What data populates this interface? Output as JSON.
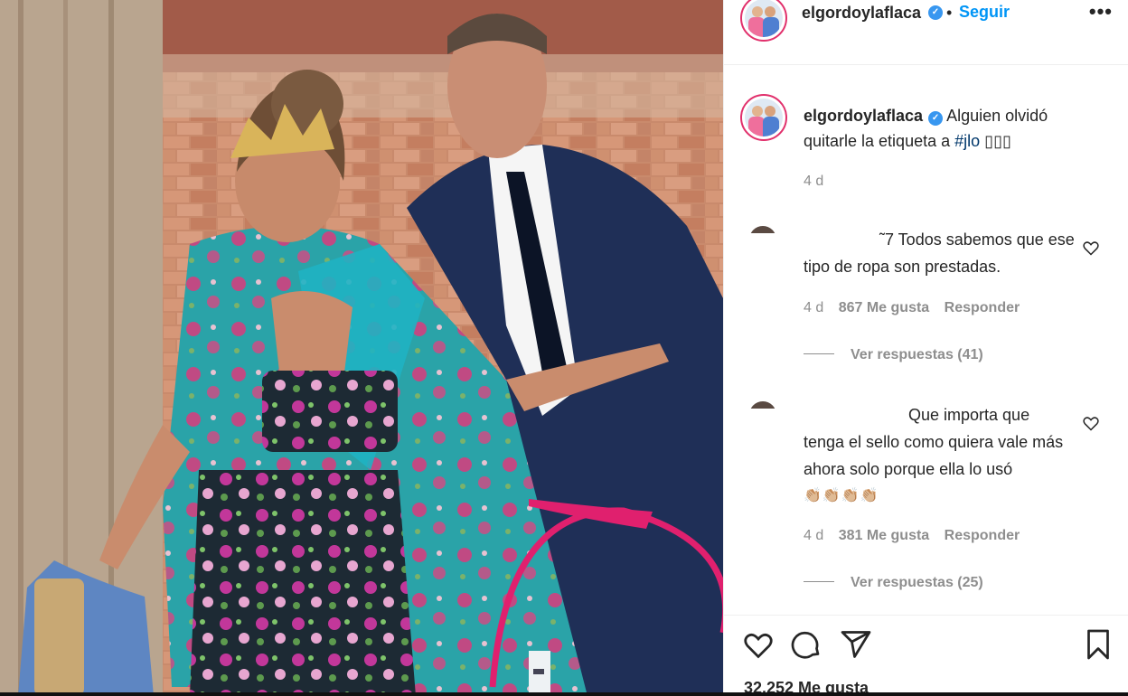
{
  "header": {
    "username": "elgordoylaflaca",
    "verified_icon": "check",
    "separator": "•",
    "follow_label": "Seguir",
    "more_label": "•••"
  },
  "caption": {
    "username": "elgordoylaflaca",
    "text": "Alguien olvidó quitarle la etiqueta a ",
    "hashtag": "#jlo",
    "trailing": " ▯▯▯",
    "time": "4 d"
  },
  "comments": [
    {
      "text": "˜7 Todos sabemos que ese tipo de ropa son prestadas.",
      "time": "4 d",
      "likes": "867 Me gusta",
      "reply_label": "Responder",
      "replies_label": "Ver respuestas (41)"
    },
    {
      "text": "Que importa que tenga el sello como quiera vale más ahora solo porque ella lo usó",
      "emoji": "👏🏼👏🏼👏🏼👏🏼",
      "time": "4 d",
      "likes": "381 Me gusta",
      "reply_label": "Responder",
      "replies_label": "Ver respuestas (25)"
    }
  ],
  "footer": {
    "likes_count": "32.252 Me gusta"
  },
  "icons": [
    "heart-icon",
    "comment-icon",
    "share-icon",
    "bookmark-icon",
    "verified-icon",
    "more-icon"
  ],
  "colors": {
    "accent_link": "#0095f6",
    "verified": "#3897f0",
    "annotation_circle": "#e0206e"
  }
}
